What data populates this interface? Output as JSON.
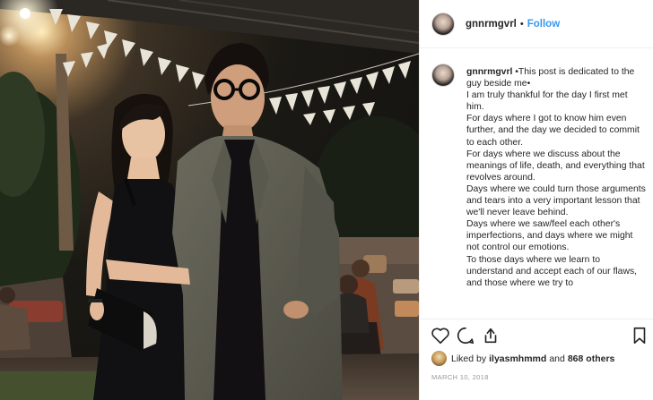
{
  "post": {
    "username": "gnnrmgvrl",
    "separator": "•",
    "follow_label": "Follow"
  },
  "caption": {
    "username": "gnnrmgvrl",
    "lines": [
      "•This post is dedicated to the guy beside me•",
      "I am truly thankful for the day I first met him.",
      "For days where I got to know him even further, and the day we decided to commit to each other.",
      "For days where we discuss about the meanings of life, death, and everything that revolves around.",
      "Days where we could turn those arguments and tears into a very important lesson that we'll never leave behind.",
      "Days where we saw/feel each other's imperfections, and days where we might not control our emotions.",
      "To those days where we learn to understand and accept each of our flaws, and those where we try to"
    ]
  },
  "actions": {
    "like_icon": "heart-icon",
    "comment_icon": "comment-icon",
    "share_icon": "share-icon",
    "save_icon": "bookmark-icon"
  },
  "likes": {
    "prefix": "Liked by",
    "liker": "ilyasmhmmd",
    "conjunction": "and",
    "others": "868 others"
  },
  "date": "MARCH 10, 2018",
  "colors": {
    "link_blue": "#3897f0",
    "text": "#262626",
    "muted": "#999999",
    "border": "#efefef"
  }
}
